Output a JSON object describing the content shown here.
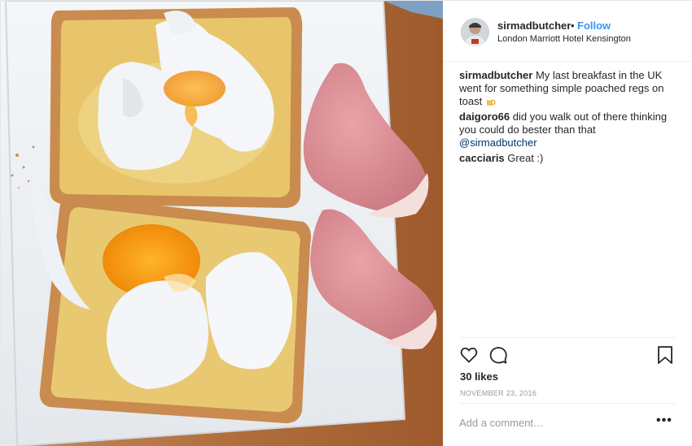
{
  "post": {
    "photo_alt": "",
    "header": {
      "username": "sirmadbutcher",
      "separator": "•",
      "follow_label": "Follow",
      "location": "London Marriott Hotel Kensington"
    },
    "comments": [
      {
        "username": "sirmadbutcher",
        "text": "My last breakfast in the UK went for something simple poached regs on toast",
        "emoji": "beer-mug-icon"
      },
      {
        "username": "daigoro66",
        "text": "did you walk out of there thinking you could do bester than that",
        "mention": "@sirmadbutcher"
      },
      {
        "username": "cacciaris",
        "text": "Great :)"
      }
    ],
    "actions": {
      "like_icon": "heart-icon",
      "comment_icon": "comment-icon",
      "save_icon": "bookmark-icon"
    },
    "likes": "30 likes",
    "date": "NOVEMBER 23, 2016",
    "add_comment_placeholder": "Add a comment…",
    "more_label": "•••"
  },
  "colors": {
    "link_blue": "#3897f0",
    "mention": "#003569",
    "muted": "#999999",
    "text": "#262626",
    "divider": "#efefef"
  }
}
